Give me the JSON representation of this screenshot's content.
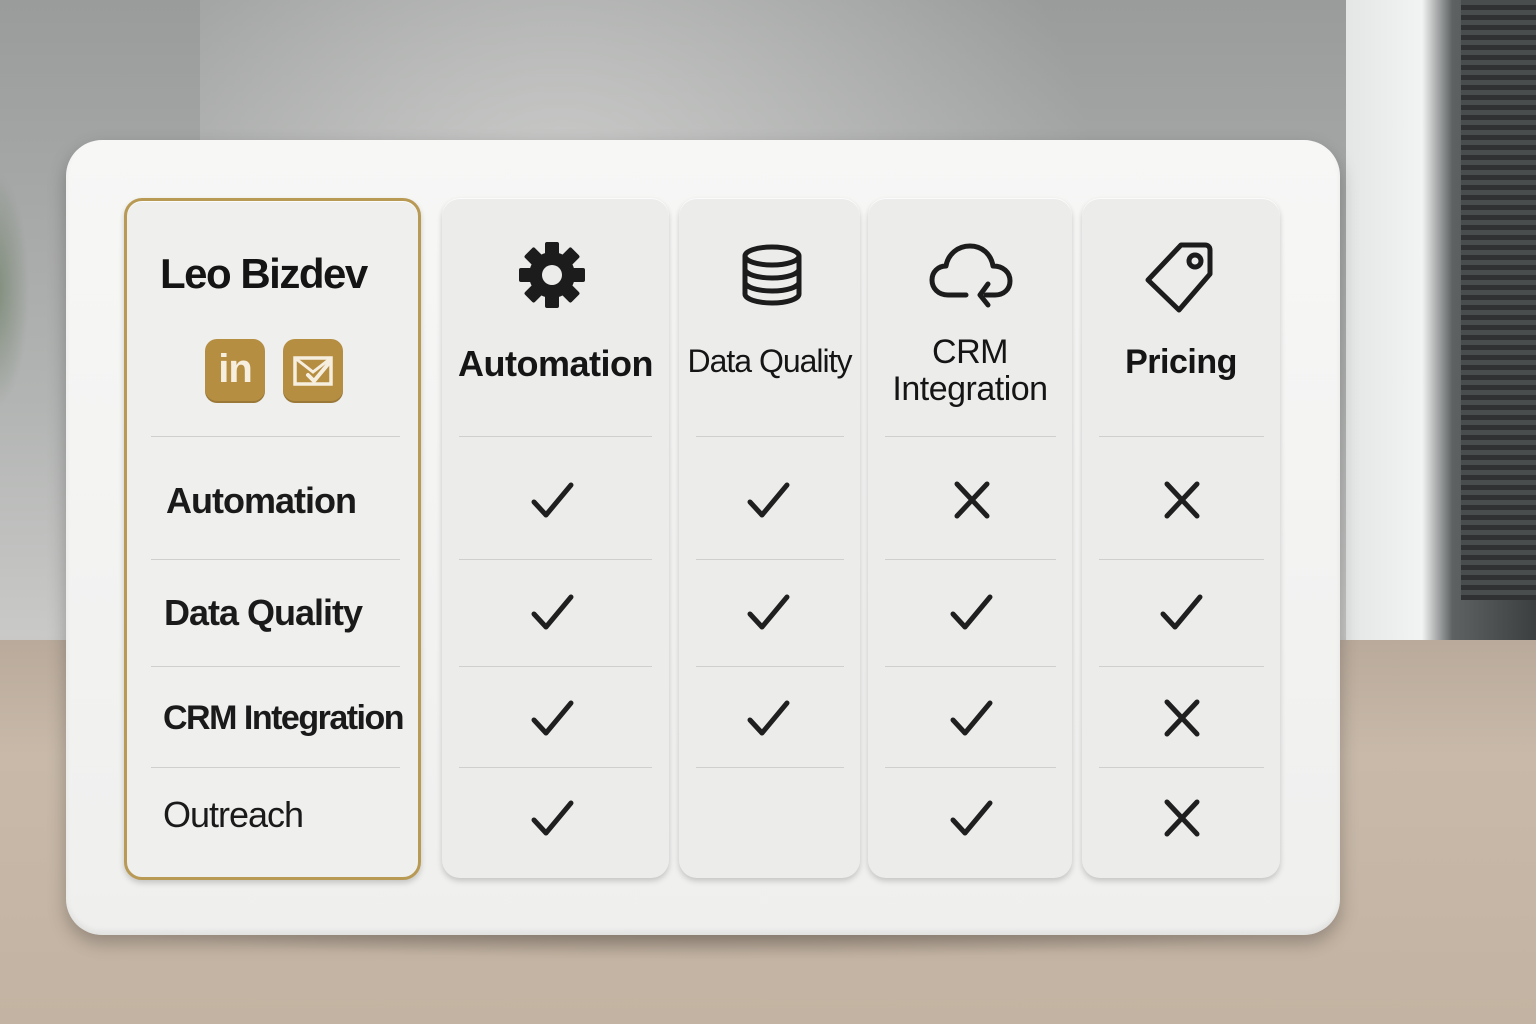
{
  "profile": {
    "name": "Leo Bizdev",
    "badges": [
      {
        "icon": "linkedin-icon",
        "label": "in"
      },
      {
        "icon": "mail-check-icon"
      }
    ]
  },
  "columns": [
    {
      "label": "Automation",
      "icon": "gear-icon"
    },
    {
      "label": "Data Quality",
      "icon": "database-icon"
    },
    {
      "label": "CRM Integration",
      "icon": "cloud-sync-icon"
    },
    {
      "label": "Pricing",
      "icon": "price-tag-icon"
    }
  ],
  "rows": [
    {
      "label": "Automation",
      "values": [
        "check",
        "check",
        "cross",
        "cross"
      ]
    },
    {
      "label": "Data Quality",
      "values": [
        "check",
        "check",
        "check",
        "check"
      ]
    },
    {
      "label": "CRM Integration",
      "values": [
        "check",
        "check",
        "check",
        "cross"
      ]
    },
    {
      "label": "Outreach",
      "values": [
        "check",
        "",
        "check",
        "cross"
      ]
    }
  ],
  "colors": {
    "accent": "#b68e42",
    "border": "#b99a55",
    "mark": "#1f1f1f"
  }
}
